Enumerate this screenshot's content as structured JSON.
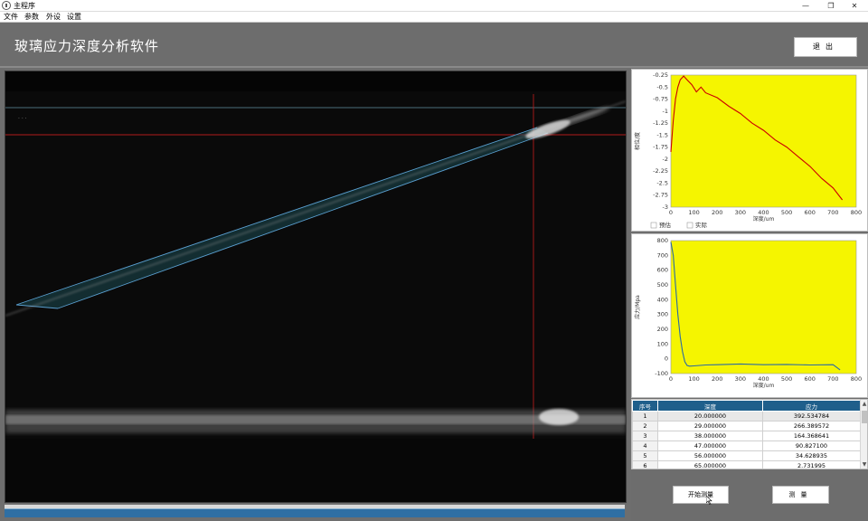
{
  "window": {
    "title": "主程序",
    "minimize_glyph": "—",
    "maximize_glyph": "❐",
    "close_glyph": "✕"
  },
  "menu": [
    "文件",
    "参数",
    "外设",
    "设置"
  ],
  "header": {
    "app_title": "玻璃应力深度分析软件",
    "exit_label": "退出"
  },
  "buttons": {
    "start_label": "开始测量",
    "save_label": "测量"
  },
  "chart_data": [
    {
      "type": "line",
      "title": "",
      "xlabel": "深度/um",
      "ylabel": "相位/度",
      "x_ticks": [
        0,
        100,
        200,
        300,
        400,
        500,
        600,
        700,
        800
      ],
      "y_ticks": [
        -0.25,
        -0.5,
        -0.75,
        -1,
        -1.25,
        -1.5,
        -1.75,
        -2,
        -2.25,
        -2.5,
        -2.75,
        -3
      ],
      "xlim": [
        0,
        800
      ],
      "ylim": [
        -3,
        -0.25
      ],
      "legend": [
        "预估",
        "实际"
      ],
      "series": [
        {
          "name": "实际",
          "color": "#cc0000",
          "x": [
            0,
            10,
            20,
            30,
            40,
            55,
            70,
            90,
            110,
            130,
            150,
            200,
            250,
            300,
            350,
            400,
            450,
            500,
            550,
            600,
            650,
            700,
            740
          ],
          "y": [
            -1.85,
            -1.2,
            -0.75,
            -0.5,
            -0.35,
            -0.27,
            -0.35,
            -0.45,
            -0.6,
            -0.5,
            -0.62,
            -0.72,
            -0.9,
            -1.05,
            -1.25,
            -1.4,
            -1.6,
            -1.75,
            -1.95,
            -2.15,
            -2.4,
            -2.6,
            -2.85
          ]
        }
      ],
      "plot_bg": "#f5f500"
    },
    {
      "type": "line",
      "title": "",
      "xlabel": "深度/um",
      "ylabel": "应力/Mpa",
      "x_ticks": [
        0,
        100,
        200,
        300,
        400,
        500,
        600,
        700,
        800
      ],
      "y_ticks": [
        800,
        700,
        600,
        500,
        400,
        300,
        200,
        100,
        0,
        -100
      ],
      "xlim": [
        0,
        800
      ],
      "ylim": [
        -100,
        800
      ],
      "series": [
        {
          "color": "#2a6aa5",
          "x": [
            0,
            10,
            20,
            30,
            40,
            50,
            60,
            70,
            80,
            100,
            150,
            200,
            300,
            400,
            500,
            600,
            700,
            730
          ],
          "y": [
            790,
            700,
            500,
            300,
            150,
            50,
            -20,
            -45,
            -50,
            -48,
            -42,
            -40,
            -35,
            -40,
            -38,
            -42,
            -40,
            -75
          ]
        }
      ],
      "plot_bg": "#f5f500"
    }
  ],
  "table": {
    "headers": [
      "序号",
      "深度",
      "应力"
    ],
    "rows": [
      [
        "1",
        "20.000000",
        "392.534784"
      ],
      [
        "2",
        "29.000000",
        "266.389572"
      ],
      [
        "3",
        "38.000000",
        "164.368641"
      ],
      [
        "4",
        "47.000000",
        "90.827100"
      ],
      [
        "5",
        "56.000000",
        "34.628935"
      ],
      [
        "6",
        "65.000000",
        "2.731995"
      ]
    ],
    "scroll_up": "▲",
    "scroll_down": "▼"
  }
}
